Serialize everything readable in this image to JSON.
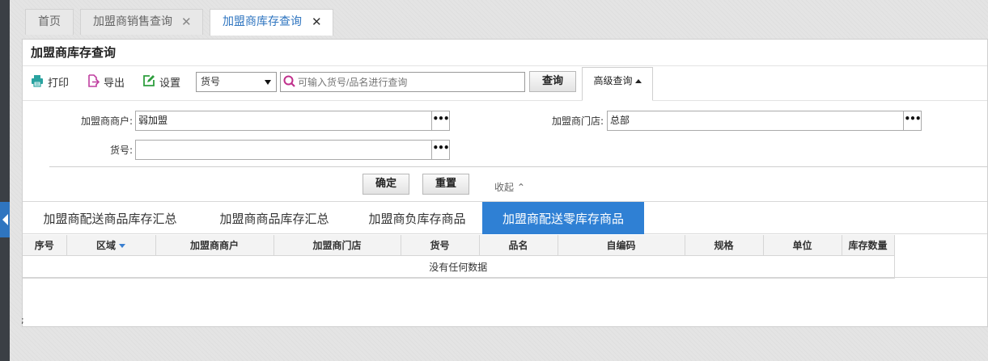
{
  "tabs": [
    {
      "label": "首页",
      "closable": false,
      "active": false
    },
    {
      "label": "加盟商销售查询",
      "closable": true,
      "active": false
    },
    {
      "label": "加盟商库存查询",
      "closable": true,
      "active": true
    }
  ],
  "tab_close_glyph": "✕",
  "panel": {
    "title": "加盟商库存查询"
  },
  "toolbar": {
    "print_label": "打印",
    "export_label": "导出",
    "settings_label": "设置",
    "search_field": {
      "selected": "货号"
    },
    "search_placeholder": "可输入货号/品名进行查询",
    "query_label": "查询",
    "advanced_label": "高级查询"
  },
  "filter": {
    "franchisee_label": "加盟商商户:",
    "franchisee_value": "弱加盟",
    "store_label": "加盟商门店:",
    "store_value": "总部",
    "item_no_label": "货号:",
    "item_no_value": "",
    "browse_glyph": "•••",
    "confirm_label": "确定",
    "reset_label": "重置",
    "collapse_label": "收起 ⌃"
  },
  "subtabs": [
    {
      "label": "加盟商配送商品库存汇总",
      "active": false
    },
    {
      "label": "加盟商商品库存汇总",
      "active": false
    },
    {
      "label": "加盟商负库存商品",
      "active": false
    },
    {
      "label": "加盟商配送零库存商品",
      "active": true
    }
  ],
  "grid": {
    "columns": [
      "序号",
      "区域",
      "加盟商商户",
      "加盟商门店",
      "货号",
      "品名",
      "自编码",
      "规格",
      "单位",
      "库存数量"
    ],
    "sorted_column": "区域",
    "rows": [],
    "empty_text": "没有任何数据"
  },
  "footer_mark": ";",
  "colors": {
    "accent": "#2f80d4",
    "active_tab_text": "#2f75c0",
    "print_icon": "#2aa3a0",
    "export_icon": "#c03fa0",
    "settings_icon": "#2e9e3e",
    "search_icon": "#c0308c"
  }
}
